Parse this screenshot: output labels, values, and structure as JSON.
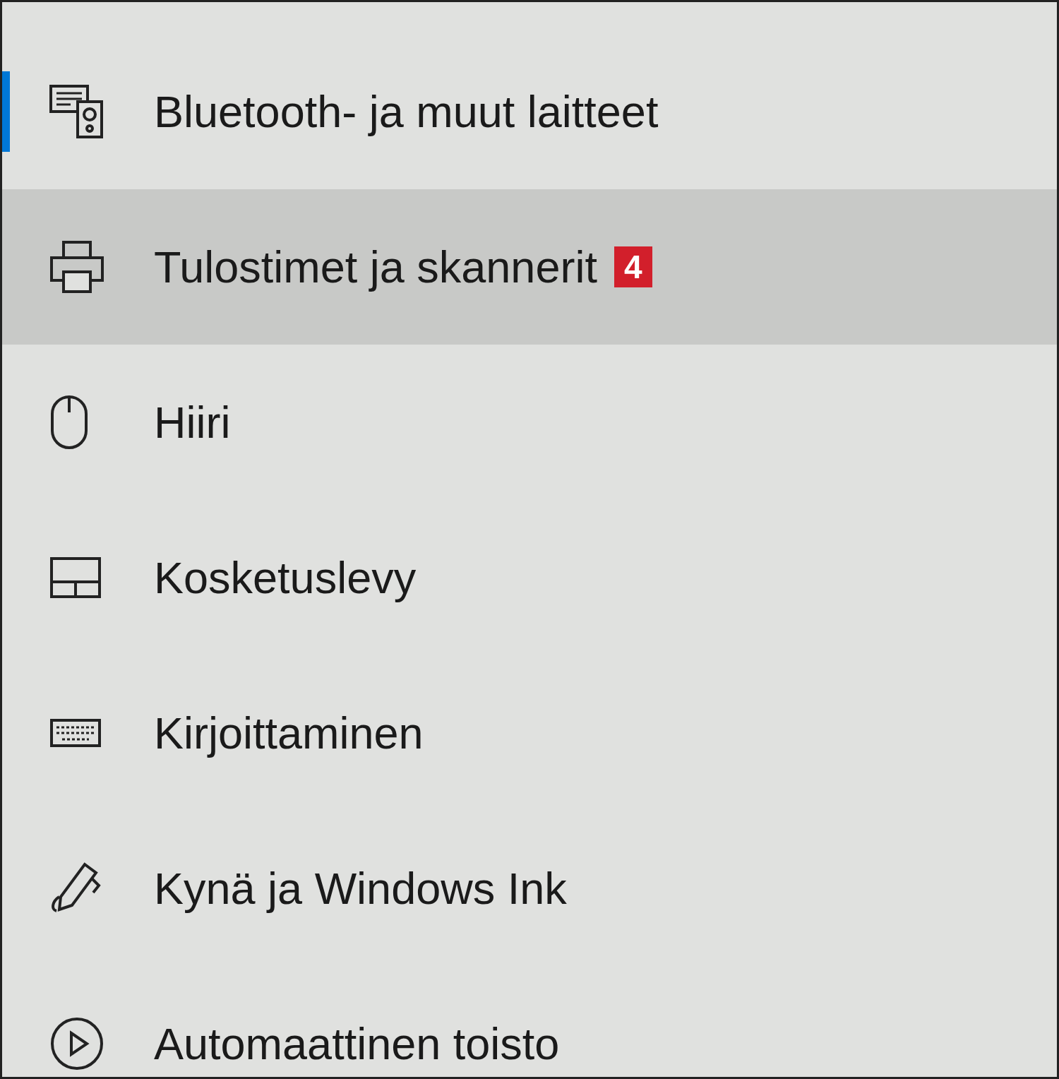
{
  "sidebar": {
    "items": [
      {
        "label": "Bluetooth- ja muut laitteet",
        "selected": true,
        "hovered": false
      },
      {
        "label": "Tulostimet ja skannerit",
        "selected": false,
        "hovered": true,
        "badge": "4"
      },
      {
        "label": "Hiiri",
        "selected": false,
        "hovered": false
      },
      {
        "label": "Kosketuslevy",
        "selected": false,
        "hovered": false
      },
      {
        "label": "Kirjoittaminen",
        "selected": false,
        "hovered": false
      },
      {
        "label": "Kynä ja Windows Ink",
        "selected": false,
        "hovered": false
      },
      {
        "label": "Automaattinen toisto",
        "selected": false,
        "hovered": false
      }
    ]
  }
}
